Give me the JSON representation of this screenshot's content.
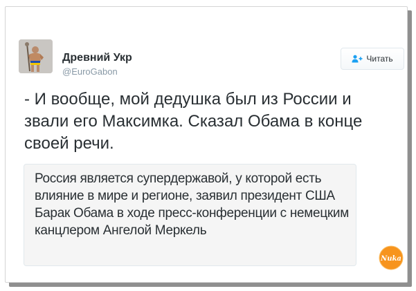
{
  "tweet": {
    "author_name": "Древний Укр",
    "author_handle": "@EuroGabon",
    "follow_label": "Читать",
    "text": "- И вообще, мой дедушка был из России и звали его Максимка. Сказал Обама в конце своей речи.",
    "quote_text": "Россия является супердержавой, у которой есть влияние в мире и регионе, заявил президент США Барак Обама в ходе пресс-конференции с немецким канцлером Ангелой Меркель"
  },
  "badge": {
    "text": "Nuka"
  },
  "colors": {
    "text": "#292f33",
    "muted": "#8899a6",
    "accent": "#1da1f2",
    "badge": "#f7941d",
    "shadow": "#8f8f8f"
  },
  "icons": {
    "follow": "add-user-icon",
    "watermark": "site-badge"
  }
}
